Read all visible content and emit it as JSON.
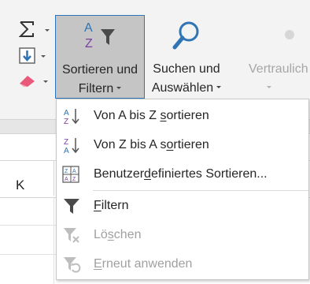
{
  "ribbon": {
    "sort_filter": {
      "line1": "Sortieren und",
      "line2": "Filtern"
    },
    "find_select": {
      "line1": "Suchen und",
      "line2": "Auswählen"
    },
    "confidentiality": {
      "line1": "Vertraulich"
    }
  },
  "sheet": {
    "column_label": "K"
  },
  "menu": {
    "items": [
      {
        "pre": "Von A bis Z ",
        "acc": "s",
        "post": "ortieren",
        "enabled": true,
        "icon": "sort-ascending-icon"
      },
      {
        "pre": "Von Z bis A s",
        "acc": "o",
        "post": "rtieren",
        "enabled": true,
        "icon": "sort-descending-icon"
      },
      {
        "pre": "Benutzer",
        "acc": "d",
        "post": "efiniertes Sortieren...",
        "enabled": true,
        "icon": "custom-sort-icon"
      },
      {
        "pre": "",
        "acc": "F",
        "post": "iltern",
        "enabled": true,
        "icon": "filter-icon"
      },
      {
        "pre": "Lö",
        "acc": "s",
        "post": "chen",
        "enabled": false,
        "icon": "clear-filter-icon"
      },
      {
        "pre": "",
        "acc": "E",
        "post": "rneut anwenden",
        "enabled": false,
        "icon": "reapply-filter-icon"
      }
    ]
  },
  "colors": {
    "accent": "#2f74b5",
    "pressed": "#c5c5c5",
    "disabled_text": "#a0a0a0",
    "eraser": "#e8597a"
  }
}
